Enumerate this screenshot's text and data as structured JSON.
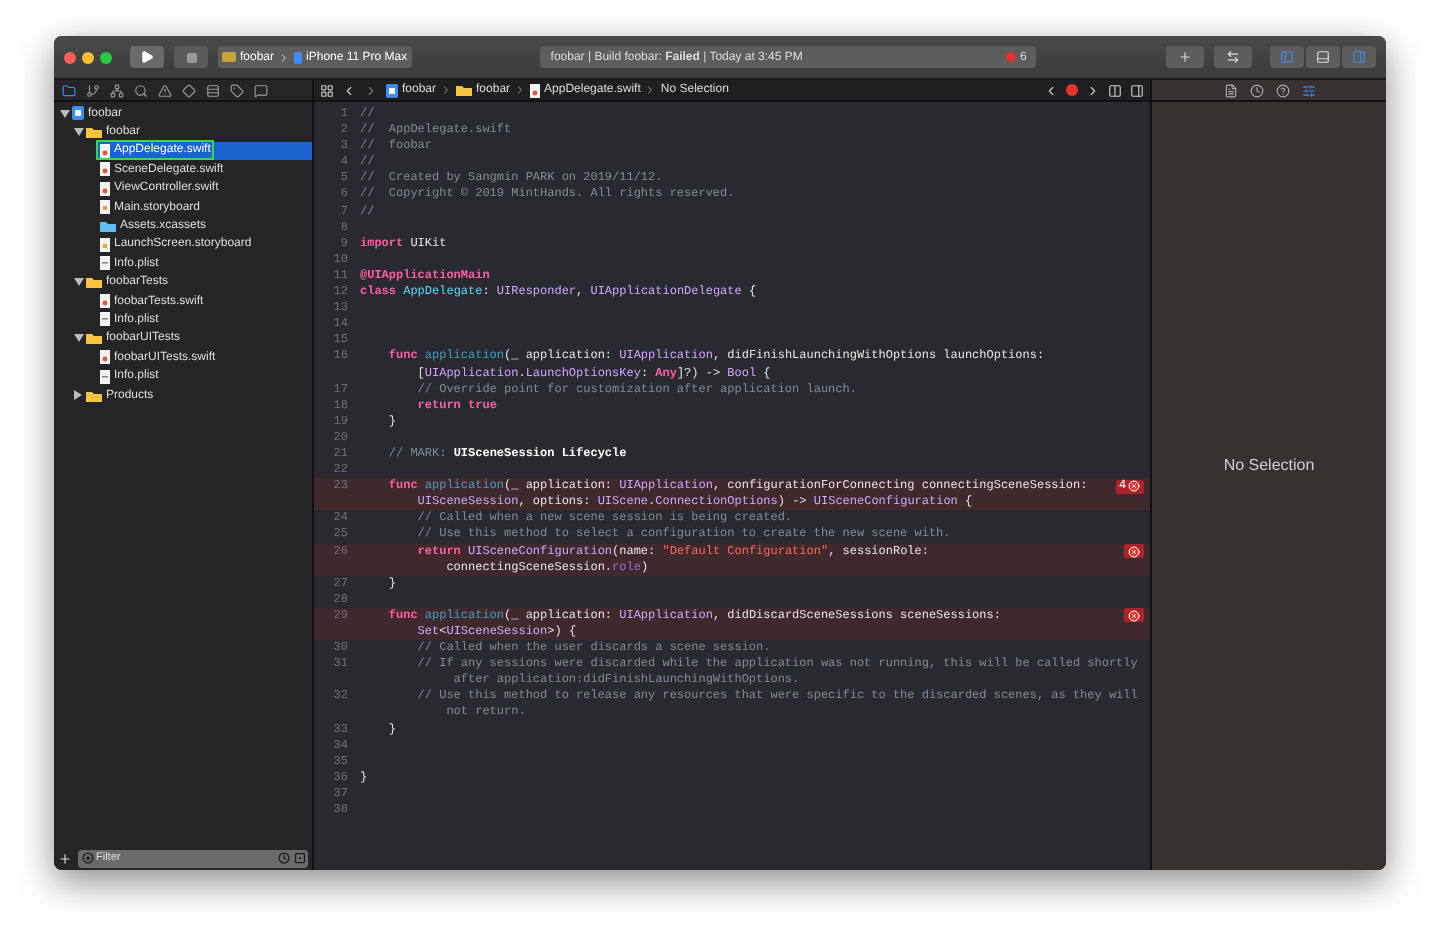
{
  "toolbar": {
    "scheme": "foobar",
    "device": "iPhone 11 Pro Max",
    "status": "foobar | Build foobar: **Failed** | Today at 3:45 PM",
    "error_count": "6",
    "panels": [
      {
        "selected": true
      },
      {
        "selected": false
      },
      {
        "selected": true
      }
    ]
  },
  "navigator_tabs": [
    {
      "selected": true
    },
    {
      "selected": false
    },
    {
      "selected": false
    },
    {
      "selected": false
    },
    {
      "selected": false
    },
    {
      "selected": false
    },
    {
      "selected": false
    },
    {
      "selected": false
    },
    {
      "selected": false
    }
  ],
  "sidebar": {
    "items": [
      {
        "label": "foobar",
        "kind": "project",
        "expanded": true,
        "selected": false,
        "children": [
          {
            "label": "foobar",
            "kind": "folder",
            "expanded": true,
            "selected": false,
            "children": [
              {
                "label": "AppDelegate.swift",
                "kind": "swift",
                "selected": true,
                "annotated": true
              },
              {
                "label": "SceneDelegate.swift",
                "kind": "swift",
                "selected": false
              },
              {
                "label": "ViewController.swift",
                "kind": "swift",
                "selected": false
              },
              {
                "label": "Main.storyboard",
                "kind": "storyboard",
                "selected": false
              },
              {
                "label": "Assets.xcassets",
                "kind": "assets",
                "selected": false
              },
              {
                "label": "LaunchScreen.storyboard",
                "kind": "storyboard",
                "selected": false
              },
              {
                "label": "Info.plist",
                "kind": "plist",
                "selected": false
              }
            ]
          },
          {
            "label": "foobarTests",
            "kind": "folder",
            "expanded": true,
            "selected": false,
            "children": [
              {
                "label": "foobarTests.swift",
                "kind": "swift",
                "selected": false
              },
              {
                "label": "Info.plist",
                "kind": "plist",
                "selected": false
              }
            ]
          },
          {
            "label": "foobarUITests",
            "kind": "folder",
            "expanded": true,
            "selected": false,
            "children": [
              {
                "label": "foobarUITests.swift",
                "kind": "swift",
                "selected": false
              },
              {
                "label": "Info.plist",
                "kind": "plist",
                "selected": false
              }
            ]
          },
          {
            "label": "Products",
            "kind": "folder",
            "expanded": false,
            "selected": false
          }
        ]
      }
    ],
    "filter": {
      "placeholder": "Filter"
    }
  },
  "jump_bar": [
    {
      "label": "foobar",
      "kind": "project"
    },
    {
      "label": "foobar",
      "kind": "folder"
    },
    {
      "label": "AppDelegate.swift",
      "kind": "swift"
    },
    {
      "label": "No Selection",
      "kind": "text"
    }
  ],
  "editor": {
    "lines": [
      {
        "number": "1",
        "rows": [
          {
            "parts": [
              {
                "kind": "comment",
                "text": "//"
              }
            ]
          }
        ]
      },
      {
        "number": "2",
        "rows": [
          {
            "parts": [
              {
                "kind": "comment",
                "text": "//  AppDelegate.swift"
              }
            ]
          }
        ]
      },
      {
        "number": "3",
        "rows": [
          {
            "parts": [
              {
                "kind": "comment",
                "text": "//  foobar"
              }
            ]
          }
        ]
      },
      {
        "number": "4",
        "rows": [
          {
            "parts": [
              {
                "kind": "comment",
                "text": "//"
              }
            ]
          }
        ]
      },
      {
        "number": "5",
        "rows": [
          {
            "parts": [
              {
                "kind": "comment",
                "text": "//  Created by Sangmin PARK on 2019/11/12."
              }
            ]
          }
        ]
      },
      {
        "number": "6",
        "rows": [
          {
            "parts": [
              {
                "kind": "comment",
                "text": "//  Copyright © 2019 MintHands. All rights reserved."
              }
            ]
          }
        ]
      },
      {
        "number": "7",
        "rows": [
          {
            "parts": [
              {
                "kind": "comment",
                "text": "//"
              }
            ]
          }
        ]
      },
      {
        "number": "8"
      },
      {
        "number": "9",
        "rows": [
          {
            "parts": [
              {
                "kind": "keyword",
                "text": "import"
              },
              {
                "kind": "plain",
                "text": " UIKit"
              }
            ]
          }
        ]
      },
      {
        "number": "10"
      },
      {
        "number": "11",
        "rows": [
          {
            "parts": [
              {
                "kind": "keyword",
                "text": "@UIApplicationMain"
              }
            ]
          }
        ]
      },
      {
        "number": "12",
        "rows": [
          {
            "parts": [
              {
                "kind": "keyword",
                "text": "class "
              },
              {
                "kind": "decl",
                "text": "AppDelegate"
              },
              {
                "kind": "plain",
                "text": ": "
              },
              {
                "kind": "type",
                "text": "UIResponder"
              },
              {
                "kind": "plain",
                "text": ", "
              },
              {
                "kind": "type",
                "text": "UIApplicationDelegate"
              },
              {
                "kind": "plain",
                "text": " {"
              }
            ]
          }
        ]
      },
      {
        "number": "13"
      },
      {
        "number": "14"
      },
      {
        "number": "15"
      },
      {
        "number": "16",
        "rows": [
          {
            "parts": [
              {
                "kind": "keyword",
                "text": "    func "
              },
              {
                "kind": "func",
                "text": "application"
              },
              {
                "kind": "plain",
                "text": "(_ application: "
              },
              {
                "kind": "type",
                "text": "UIApplication"
              },
              {
                "kind": "plain",
                "text": ", didFinishLaunchingWithOptions launchOptions:"
              }
            ]
          },
          {
            "parts": [
              {
                "kind": "plain",
                "text": "        ["
              },
              {
                "kind": "type",
                "text": "UIApplication"
              },
              {
                "kind": "plain",
                "text": "."
              },
              {
                "kind": "type",
                "text": "LaunchOptionsKey"
              },
              {
                "kind": "plain",
                "text": ": "
              },
              {
                "kind": "keyword",
                "text": "Any"
              },
              {
                "kind": "plain",
                "text": "]?) -> "
              },
              {
                "kind": "type",
                "text": "Bool"
              },
              {
                "kind": "plain",
                "text": " {"
              }
            ]
          }
        ]
      },
      {
        "number": "17",
        "rows": [
          {
            "parts": [
              {
                "kind": "comment",
                "text": "        // Override point for customization after application launch."
              }
            ]
          }
        ]
      },
      {
        "number": "18",
        "rows": [
          {
            "parts": [
              {
                "kind": "keyword",
                "text": "        return "
              },
              {
                "kind": "keyword",
                "text": "true"
              }
            ]
          }
        ]
      },
      {
        "number": "19",
        "rows": [
          {
            "parts": [
              {
                "kind": "plain",
                "text": "    }"
              }
            ]
          }
        ]
      },
      {
        "number": "20"
      },
      {
        "number": "21",
        "rows": [
          {
            "parts": [
              {
                "kind": "comment",
                "text": "    // MARK: "
              },
              {
                "kind": "mark",
                "text": "UISceneSession Lifecycle"
              }
            ]
          }
        ]
      },
      {
        "number": "22"
      },
      {
        "number": "23",
        "error": true,
        "badge": "4",
        "rows": [
          {
            "parts": [
              {
                "kind": "keyword",
                "text": "    func "
              },
              {
                "kind": "func",
                "text": "application"
              },
              {
                "kind": "plain",
                "text": "(_ application: "
              },
              {
                "kind": "type",
                "text": "UIApplication"
              },
              {
                "kind": "plain",
                "text": ", configurationForConnecting connectingSceneSession:"
              }
            ]
          },
          {
            "parts": [
              {
                "kind": "type",
                "text": "        UISceneSession"
              },
              {
                "kind": "plain",
                "text": ", options: "
              },
              {
                "kind": "type",
                "text": "UIScene"
              },
              {
                "kind": "plain",
                "text": "."
              },
              {
                "kind": "type",
                "text": "ConnectionOptions"
              },
              {
                "kind": "plain",
                "text": ") -> "
              },
              {
                "kind": "type",
                "text": "UISceneConfiguration"
              },
              {
                "kind": "plain",
                "text": " {"
              }
            ]
          }
        ]
      },
      {
        "number": "24",
        "rows": [
          {
            "parts": [
              {
                "kind": "comment",
                "text": "        // Called when a new scene session is being created."
              }
            ]
          }
        ]
      },
      {
        "number": "25",
        "rows": [
          {
            "parts": [
              {
                "kind": "comment",
                "text": "        // Use this method to select a configuration to create the new scene with."
              }
            ]
          }
        ]
      },
      {
        "number": "26",
        "error": true,
        "rows": [
          {
            "parts": [
              {
                "kind": "keyword",
                "text": "        return "
              },
              {
                "kind": "type",
                "text": "UISceneConfiguration"
              },
              {
                "kind": "plain",
                "text": "(name: "
              },
              {
                "kind": "string",
                "text": "\"Default Configuration\""
              },
              {
                "kind": "plain",
                "text": ", sessionRole:"
              }
            ]
          },
          {
            "parts": [
              {
                "kind": "plain",
                "text": "            connectingSceneSession."
              },
              {
                "kind": "prop",
                "text": "role"
              },
              {
                "kind": "plain",
                "text": ")"
              }
            ]
          }
        ]
      },
      {
        "number": "27",
        "rows": [
          {
            "parts": [
              {
                "kind": "plain",
                "text": "    }"
              }
            ]
          }
        ]
      },
      {
        "number": "28"
      },
      {
        "number": "29",
        "error": true,
        "rows": [
          {
            "parts": [
              {
                "kind": "keyword",
                "text": "    func "
              },
              {
                "kind": "func",
                "text": "application"
              },
              {
                "kind": "plain",
                "text": "(_ application: "
              },
              {
                "kind": "type",
                "text": "UIApplication"
              },
              {
                "kind": "plain",
                "text": ", didDiscardSceneSessions sceneSessions:"
              }
            ]
          },
          {
            "parts": [
              {
                "kind": "type",
                "text": "        Set"
              },
              {
                "kind": "plain",
                "text": "<"
              },
              {
                "kind": "type",
                "text": "UISceneSession"
              },
              {
                "kind": "plain",
                "text": ">) {"
              }
            ]
          }
        ]
      },
      {
        "number": "30",
        "rows": [
          {
            "parts": [
              {
                "kind": "comment",
                "text": "        // Called when the user discards a scene session."
              }
            ]
          }
        ]
      },
      {
        "number": "31",
        "rows": [
          {
            "parts": [
              {
                "kind": "comment",
                "text": "        // If any sessions were discarded while the application was not running, this will be called shortly"
              }
            ]
          },
          {
            "parts": [
              {
                "kind": "comment",
                "text": "             after application:didFinishLaunchingWithOptions."
              }
            ]
          }
        ]
      },
      {
        "number": "32",
        "rows": [
          {
            "parts": [
              {
                "kind": "comment",
                "text": "        // Use this method to release any resources that were specific to the discarded scenes, as they will"
              }
            ]
          },
          {
            "parts": [
              {
                "kind": "comment",
                "text": "            not return."
              }
            ]
          }
        ]
      },
      {
        "number": "33",
        "rows": [
          {
            "parts": [
              {
                "kind": "plain",
                "text": "    }"
              }
            ]
          }
        ]
      },
      {
        "number": "34"
      },
      {
        "number": "35"
      },
      {
        "number": "36",
        "rows": [
          {
            "parts": [
              {
                "kind": "plain",
                "text": "}"
              }
            ]
          }
        ]
      },
      {
        "number": "37"
      },
      {
        "number": "38"
      }
    ]
  },
  "inspector_tabs": [
    {
      "selected": false
    },
    {
      "selected": false
    },
    {
      "selected": false
    },
    {
      "selected": true
    }
  ],
  "inspector": {
    "message": "No Selection"
  }
}
